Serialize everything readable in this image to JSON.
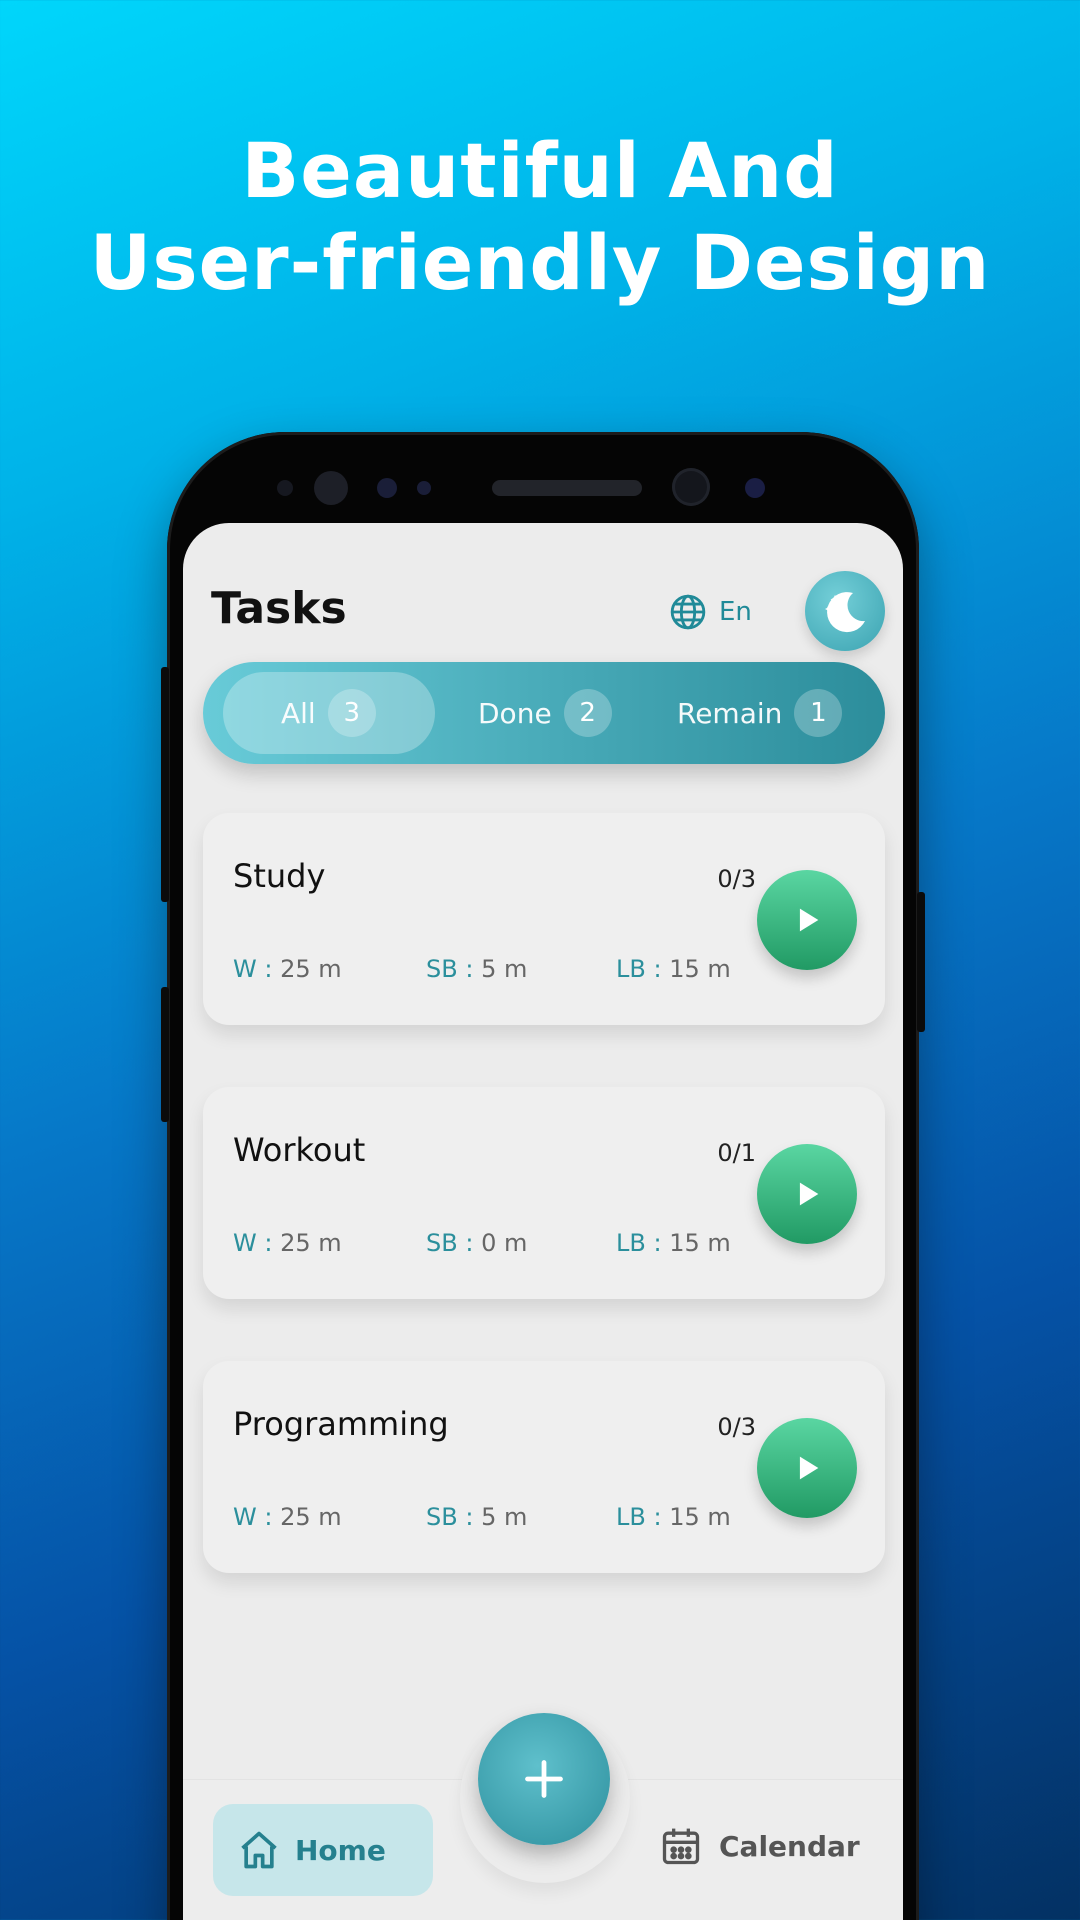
{
  "headline": {
    "line1": "Beautiful And",
    "line2": "User-friendly Design"
  },
  "app": {
    "title": "Tasks",
    "language": "En",
    "tabs": [
      {
        "label": "All",
        "count": "3"
      },
      {
        "label": "Done",
        "count": "2"
      },
      {
        "label": "Remain",
        "count": "1"
      }
    ],
    "tasks": [
      {
        "name": "Study",
        "progress": "0/3",
        "w_key": "W :",
        "w_val": "25 m",
        "sb_key": "SB :",
        "sb_val": "5 m",
        "lb_key": "LB :",
        "lb_val": "15 m"
      },
      {
        "name": "Workout",
        "progress": "0/1",
        "w_key": "W :",
        "w_val": "25 m",
        "sb_key": "SB :",
        "sb_val": "0 m",
        "lb_key": "LB :",
        "lb_val": "15 m"
      },
      {
        "name": "Programming",
        "progress": "0/3",
        "w_key": "W :",
        "w_val": "25 m",
        "sb_key": "SB :",
        "sb_val": "5 m",
        "lb_key": "LB :",
        "lb_val": "15 m"
      }
    ],
    "nav": {
      "home": "Home",
      "calendar": "Calendar"
    }
  },
  "icons": [
    "globe-icon",
    "moon-icon",
    "play-icon",
    "plus-icon",
    "home-icon",
    "calendar-icon"
  ],
  "colors": {
    "accent": "#2b8f9c",
    "play": "#2fb27a",
    "background_top": "#00d6fb",
    "background_bottom": "#033163"
  }
}
